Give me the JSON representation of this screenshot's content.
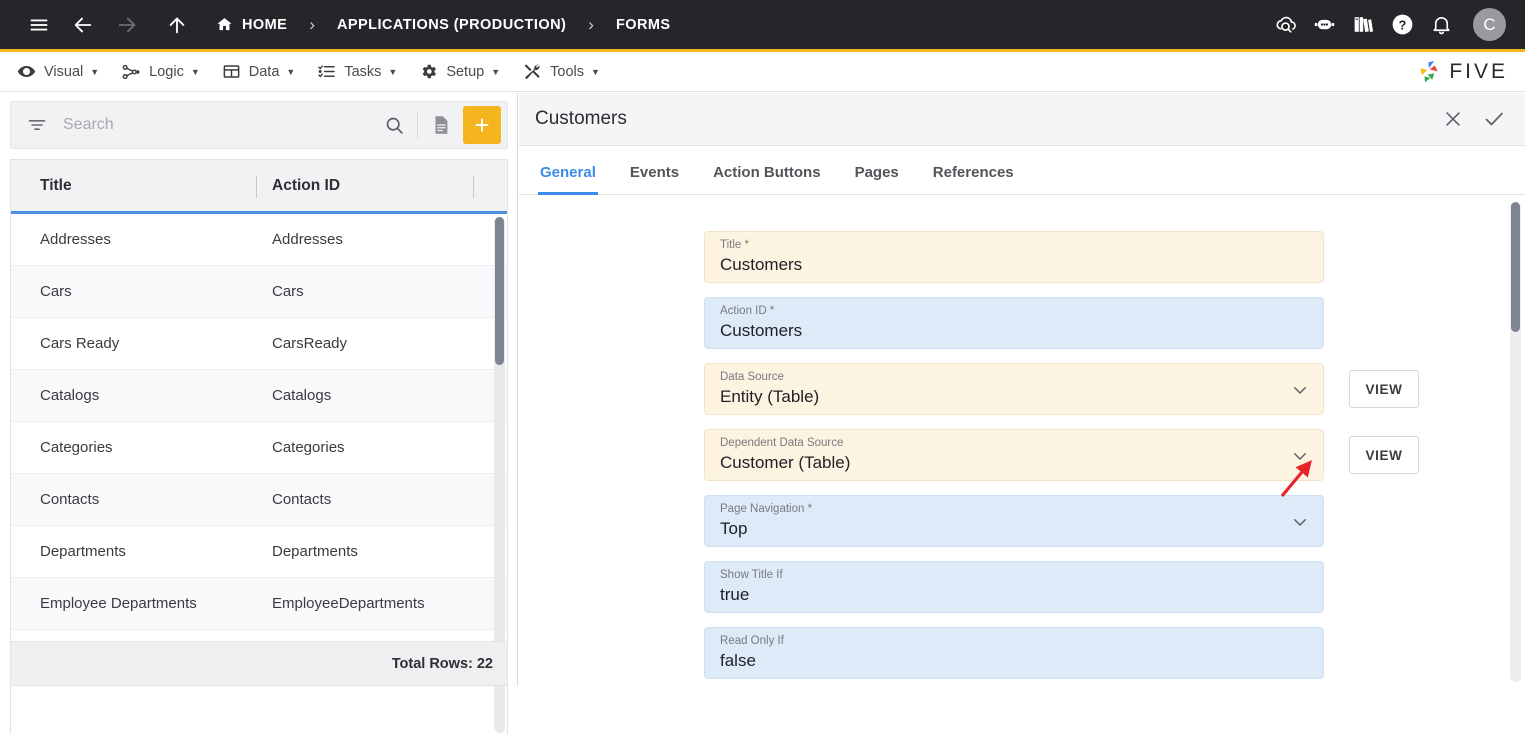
{
  "topbar": {
    "menu_icon": "hamburger-menu-icon",
    "back_icon": "back-arrow-icon",
    "forward_icon": "forward-arrow-icon",
    "up_icon": "up-arrow-icon",
    "breadcrumbs": [
      {
        "label": "HOME",
        "icon": "home-icon"
      },
      {
        "label": "APPLICATIONS (PRODUCTION)",
        "icon": ""
      },
      {
        "label": "FORMS",
        "icon": ""
      }
    ],
    "separator": "›",
    "right_icons": [
      "cloud-search-icon",
      "chat-bot-icon",
      "library-books-icon",
      "help-circle-icon",
      "notification-bell-icon"
    ],
    "avatar_initial": "C"
  },
  "menubar": {
    "items": [
      {
        "label": "Visual",
        "icon": "eye-icon"
      },
      {
        "label": "Logic",
        "icon": "node-graph-icon"
      },
      {
        "label": "Data",
        "icon": "table-grid-icon"
      },
      {
        "label": "Tasks",
        "icon": "checklist-icon"
      },
      {
        "label": "Setup",
        "icon": "gear-icon"
      },
      {
        "label": "Tools",
        "icon": "tools-icon"
      }
    ],
    "caret": "▼",
    "logo_text": "FIVE"
  },
  "search": {
    "placeholder": "Search",
    "value": "",
    "filter_icon": "filter-icon",
    "search_icon": "search-icon",
    "document_icon": "document-icon",
    "add_label": "+"
  },
  "list": {
    "columns": [
      "Title",
      "Action ID"
    ],
    "rows": [
      {
        "title": "Addresses",
        "action_id": "Addresses"
      },
      {
        "title": "Cars",
        "action_id": "Cars"
      },
      {
        "title": "Cars Ready",
        "action_id": "CarsReady"
      },
      {
        "title": "Catalogs",
        "action_id": "Catalogs"
      },
      {
        "title": "Categories",
        "action_id": "Categories"
      },
      {
        "title": "Contacts",
        "action_id": "Contacts"
      },
      {
        "title": "Departments",
        "action_id": "Departments"
      },
      {
        "title": "Employee Departments",
        "action_id": "EmployeeDepartments"
      }
    ],
    "total_rows_label": "Total Rows: 22"
  },
  "detail": {
    "title": "Customers",
    "close_icon": "close-icon",
    "save_icon": "check-icon",
    "tabs": [
      {
        "label": "General",
        "active": true
      },
      {
        "label": "Events",
        "active": false
      },
      {
        "label": "Action Buttons",
        "active": false
      },
      {
        "label": "Pages",
        "active": false
      },
      {
        "label": "References",
        "active": false
      }
    ],
    "fields": [
      {
        "label": "Title *",
        "value": "Customers",
        "style": "yellow",
        "dropdown": false,
        "view": false
      },
      {
        "label": "Action ID *",
        "value": "Customers",
        "style": "blue",
        "dropdown": false,
        "view": false
      },
      {
        "label": "Data Source",
        "value": "Entity (Table)",
        "style": "yellow",
        "dropdown": true,
        "view": true
      },
      {
        "label": "Dependent Data Source",
        "value": "Customer (Table)",
        "style": "yellow",
        "dropdown": true,
        "view": true
      },
      {
        "label": "Page Navigation *",
        "value": "Top",
        "style": "blue",
        "dropdown": true,
        "view": false
      },
      {
        "label": "Show Title If",
        "value": "true",
        "style": "blue",
        "dropdown": false,
        "view": false
      },
      {
        "label": "Read Only If",
        "value": "false",
        "style": "blue",
        "dropdown": false,
        "view": false
      }
    ],
    "view_button_label": "VIEW"
  },
  "annotation": {
    "type": "red-arrow",
    "color": "#e8242a",
    "points_at": "dependent-data-source-dropdown"
  },
  "colors": {
    "topbar_bg": "#26262a",
    "accent_yellow": "#f5b720",
    "tab_active_blue": "#3d8bea",
    "field_yellow": "#fdf3e1",
    "field_blue": "#ddeaf8"
  }
}
